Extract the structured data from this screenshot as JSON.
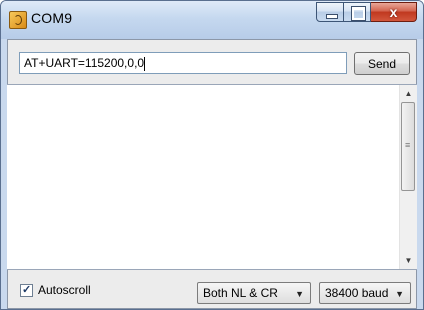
{
  "window": {
    "title": "COM9",
    "controls": {
      "minimize": "minimize",
      "maximize": "maximize",
      "close": "x"
    }
  },
  "command": {
    "value": "AT+UART=115200,0,0",
    "send_label": "Send"
  },
  "footer": {
    "autoscroll_label": "Autoscroll",
    "autoscroll_checked": true,
    "line_ending": "Both NL & CR",
    "baud_rate": "38400 baud"
  },
  "icons": {
    "app": "arduino-app-icon",
    "dropdown": "chevron-down-icon"
  },
  "colors": {
    "titlebar": "#c5d8ef",
    "close_button": "#c0381f",
    "client_bg": "#ececec"
  }
}
